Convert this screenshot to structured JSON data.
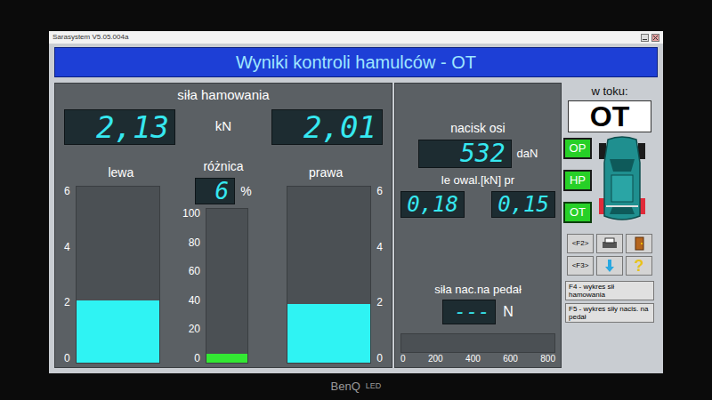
{
  "monitor": {
    "brand": "BenQ",
    "label": "LED"
  },
  "window": {
    "title": "Sarasystem V5.05.004a"
  },
  "header": "Wyniki kontroli hamulców - OT",
  "braking": {
    "label": "siła hamowania",
    "unit": "kN",
    "left": {
      "label": "lewa",
      "value": "2,13",
      "level": 0.355
    },
    "right": {
      "label": "prawa",
      "value": "2,01",
      "level": 0.335
    },
    "difference": {
      "label": "różnica",
      "value": "6",
      "unit": "%",
      "level": 0.06
    },
    "scale": [
      "6",
      "4",
      "2",
      "0"
    ],
    "diff_scale": [
      "100",
      "80",
      "60",
      "40",
      "20",
      "0"
    ]
  },
  "axle": {
    "label": "nacisk osi",
    "value": "532",
    "unit": "daN"
  },
  "ovality": {
    "label": "le owal.[kN] pr",
    "left": "0,18",
    "right": "0,15"
  },
  "pedal": {
    "label": "siła nac.na pedał",
    "value": "---",
    "unit": "N",
    "level": 0,
    "scale": [
      "0",
      "200",
      "400",
      "600",
      "800"
    ]
  },
  "status": {
    "label": "w toku:",
    "value": "OT"
  },
  "axles": [
    {
      "label": "OP",
      "selected": false
    },
    {
      "label": "HP",
      "selected": false
    },
    {
      "label": "OT",
      "selected": true
    }
  ],
  "keys": [
    "<F2>",
    "<F3>"
  ],
  "help": "?",
  "functions": [
    "F4 - wykres sił hamowania",
    "F5 - wykres siły nacis. na pedał"
  ]
}
